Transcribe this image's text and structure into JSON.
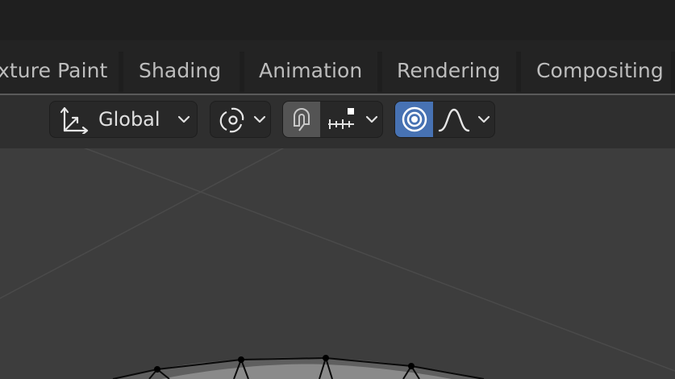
{
  "workspace_tabs": [
    {
      "label": "xture Paint"
    },
    {
      "label": "Shading"
    },
    {
      "label": "Animation"
    },
    {
      "label": "Rendering"
    },
    {
      "label": "Compositing"
    }
  ],
  "header": {
    "transform_orientation": {
      "value": "Global",
      "icon": "transform-axes-icon"
    },
    "pivot_icon": "pivot-point-icon",
    "snap_icon": "magnet-snap-icon",
    "snap_target_icon": "snap-increment-icon",
    "proportional_icon": "proportional-editing-icon",
    "falloff_icon": "falloff-curve-icon"
  },
  "colors": {
    "accent": "#4772b3",
    "panel_bg": "#2f2f2f",
    "tabs_bg": "#232323",
    "viewport_bg": "#3d3d3d"
  }
}
